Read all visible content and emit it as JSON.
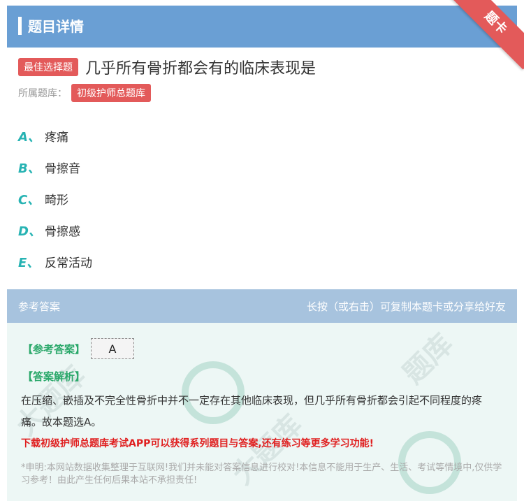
{
  "header": {
    "title": "题目详情",
    "ribbon_text": "题卡"
  },
  "question": {
    "type_badge": "最佳选择题",
    "text": "几乎所有骨折都会有的临床表现是",
    "bank_label": "所属题库：",
    "bank_name": "初级护师总题库"
  },
  "options": [
    {
      "letter": "A、",
      "text": "疼痛"
    },
    {
      "letter": "B、",
      "text": "骨擦音"
    },
    {
      "letter": "C、",
      "text": "畸形"
    },
    {
      "letter": "D、",
      "text": "骨擦感"
    },
    {
      "letter": "E、",
      "text": "反常活动"
    }
  ],
  "answer_bar": {
    "left": "参考答案",
    "right": "长按（或右击）可复制本题卡或分享给好友"
  },
  "answer": {
    "ref_label": "【参考答案】",
    "value": "A",
    "analysis_label": "【答案解析】",
    "analysis_text": "在压缩、嵌插及不完全性骨折中并不一定存在其他临床表现，但几乎所有骨折都会引起不同程度的疼痛。故本题选A。",
    "promo": "下载初级护师总题库考试APP可以获得系列题目与答案,还有练习等更多学习功能!",
    "disclaimer": "*申明:本网站数据收集整理于互联网!我们并未能对答案信息进行校对!本信息不能用于生产、生活、考试等情境中,仅供学习参考！由此产生任何后果本站不承担责任!"
  },
  "colors": {
    "header_blue": "#6a9fd4",
    "badge_red": "#e35a5a",
    "option_teal": "#27b3b3",
    "answer_green": "#2aa86a",
    "promo_red": "#e02020"
  }
}
